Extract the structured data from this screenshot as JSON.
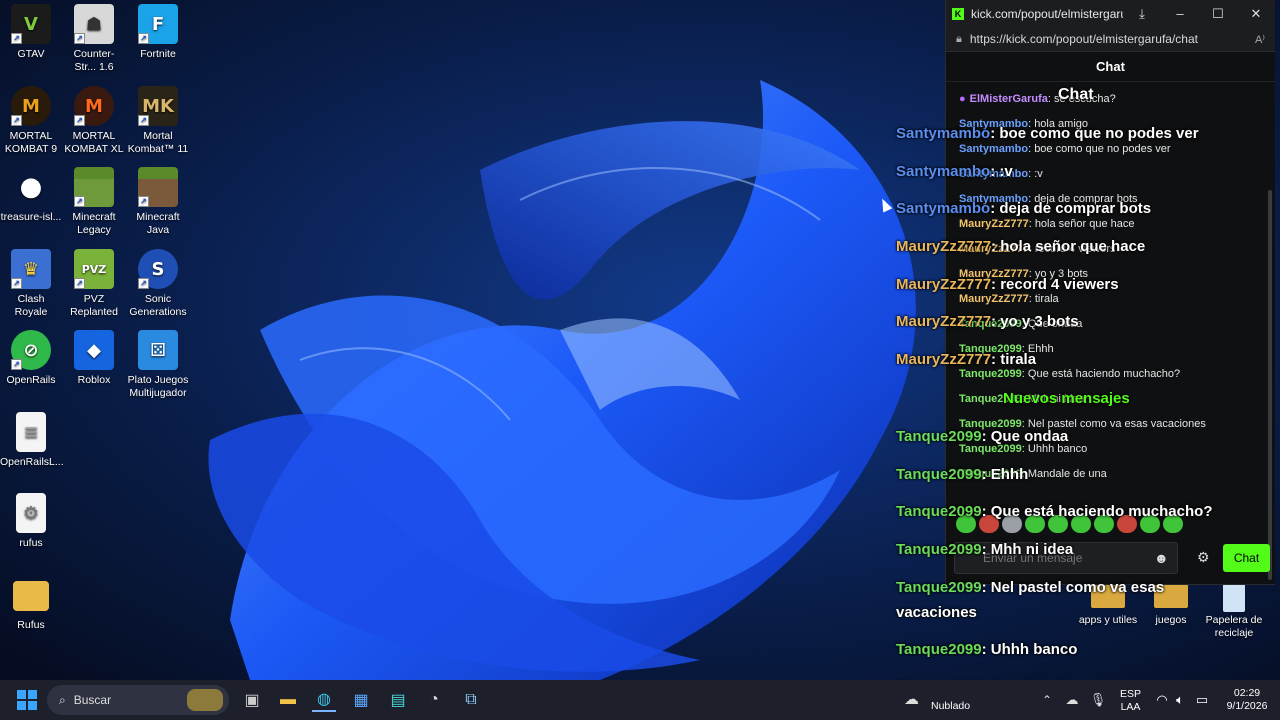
{
  "desktop": {
    "icons": [
      {
        "label": "GTAV",
        "icon": "gta-icon"
      },
      {
        "label": "Counter-Str... 1.6",
        "icon": "counter-strike-icon"
      },
      {
        "label": "Fortnite",
        "icon": "fortnite-icon"
      },
      {
        "label": "MORTAL KOMBAT 9",
        "icon": "mortal-kombat-9-icon"
      },
      {
        "label": "MORTAL KOMBAT XL",
        "icon": "mortal-kombat-xl-icon"
      },
      {
        "label": "Mortal Kombat™ 11",
        "icon": "mortal-kombat-11-icon"
      },
      {
        "label": "treasure-isl...",
        "icon": "mickey-icon"
      },
      {
        "label": "Minecraft Legacy",
        "icon": "minecraft-legacy-icon"
      },
      {
        "label": "Minecraft Java",
        "icon": "minecraft-java-icon"
      },
      {
        "label": "Clash Royale",
        "icon": "clash-royale-icon"
      },
      {
        "label": "PVZ Replanted",
        "icon": "pvz-icon"
      },
      {
        "label": "Sonic Generations",
        "icon": "sonic-icon"
      },
      {
        "label": "OpenRails",
        "icon": "openrails-icon"
      },
      {
        "label": "Roblox",
        "icon": "roblox-icon"
      },
      {
        "label": "Plato Juegos Multijugador",
        "icon": "plato-icon"
      },
      {
        "label": "OpenRailsL...",
        "icon": "text-file-icon"
      },
      {
        "label": "rufus",
        "icon": "rufus-file-icon"
      },
      {
        "label": "Rufus",
        "icon": "folder-icon"
      }
    ],
    "right_icons": [
      {
        "label": "apps y utiles",
        "icon": "folder-icon"
      },
      {
        "label": "juegos",
        "icon": "folder-icon"
      },
      {
        "label": "Papelera de reciclaje",
        "icon": "recycle-bin-icon"
      }
    ]
  },
  "popup": {
    "title": "kick.com/popout/elmistergaru...",
    "url": "https://kick.com/popout/elmistergarufa/chat",
    "header": "Chat",
    "messages": [
      {
        "user": "ElMisterGarufa",
        "text": ": se escucha?",
        "color": "#c58cff"
      },
      {
        "user": "Santymambo",
        "text": ": hola amigo",
        "color": "#6aa0ff"
      },
      {
        "user": "Santymambo",
        "text": ": boe como que no podes ver",
        "color": "#6aa0ff"
      },
      {
        "user": "Santymambo",
        "text": ": :v",
        "color": "#6aa0ff"
      },
      {
        "user": "Santymambo",
        "text": ": deja de comprar bots",
        "color": "#6aa0ff"
      },
      {
        "user": "MauryZzZ777",
        "text": ": hola señor que hace",
        "color": "#f3c36b"
      },
      {
        "user": "MauryZzZ777",
        "text": ": record 4 viewers",
        "color": "#f3c36b"
      },
      {
        "user": "MauryZzZ777",
        "text": ": yo y 3 bots",
        "color": "#f3c36b"
      },
      {
        "user": "MauryZzZ777",
        "text": ": tirala",
        "color": "#f3c36b"
      },
      {
        "user": "Tanque2099",
        "text": ": Que ondaa",
        "color": "#7de86a"
      },
      {
        "user": "Tanque2099",
        "text": ": Ehhh",
        "color": "#7de86a"
      },
      {
        "user": "Tanque2099",
        "text": ": Que está haciendo muchacho?",
        "color": "#7de86a"
      },
      {
        "user": "Tanque2099",
        "text": ": Mhh ni idea",
        "color": "#7de86a"
      },
      {
        "user": "Tanque2099",
        "text": ": Nel pastel como va esas vacaciones",
        "color": "#7de86a"
      },
      {
        "user": "Tanque2099",
        "text": ": Uhhh banco",
        "color": "#7de86a"
      },
      {
        "user": "Tanque2099",
        "text": ": Mandale de una",
        "color": "#7de86a"
      }
    ],
    "input_placeholder": "Enviar un mensaje",
    "send_label": "Chat"
  },
  "overlay": {
    "title": "Chat",
    "new_messages": "Nuevos mensajes",
    "lines": [
      {
        "user": "Santymambo",
        "text": ": boe como que no podes ver",
        "color": "#5b8ef0"
      },
      {
        "user": "Santymambo",
        "text": ": :v",
        "color": "#5b8ef0"
      },
      {
        "user": "Santymambo",
        "text": ": deja de comprar bots",
        "color": "#5b8ef0"
      },
      {
        "user": "MauryZzZ777",
        "text": ": hola señor que hace",
        "color": "#e9b65c"
      },
      {
        "user": "MauryZzZ777",
        "text": ": record 4 viewers",
        "color": "#e9b65c"
      },
      {
        "user": "MauryZzZ777",
        "text": ": yo y 3 bots",
        "color": "#e9b65c"
      },
      {
        "user": "MauryZzZ777",
        "text": ": tirala",
        "color": "#e9b65c"
      },
      {
        "user": "Tanque2099",
        "text": ": Que ondaa",
        "color": "#6bdc5a"
      },
      {
        "user": "Tanque2099",
        "text": ": Ehhh",
        "color": "#6bdc5a"
      },
      {
        "user": "Tanque2099",
        "text": ": Que está haciendo muchacho?",
        "color": "#6bdc5a"
      },
      {
        "user": "Tanque2099",
        "text": ": Mhh ni idea",
        "color": "#6bdc5a"
      },
      {
        "user": "Tanque2099",
        "text": ": Nel pastel como va esas",
        "color": "#6bdc5a"
      },
      {
        "user": "",
        "text": "vacaciones",
        "color": "#6bdc5a"
      },
      {
        "user": "Tanque2099",
        "text": ": Uhhh banco",
        "color": "#6bdc5a"
      },
      {
        "user": "Tanque2099",
        "text": ": Mandale de una",
        "color": "#6bdc5a"
      }
    ]
  },
  "taskbar": {
    "search_placeholder": "Buscar",
    "weather": "Nublado",
    "lang_top": "ESP",
    "lang_bottom": "LAA",
    "time": "02:29",
    "date": "9/1/2026"
  }
}
